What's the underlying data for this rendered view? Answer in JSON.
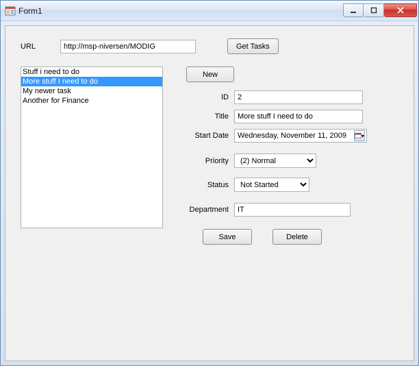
{
  "window": {
    "title": "Form1"
  },
  "url": {
    "label": "URL",
    "value": "http://msp-niversen/MODIG"
  },
  "buttons": {
    "getTasks": "Get Tasks",
    "new": "New",
    "save": "Save",
    "delete": "Delete"
  },
  "tasks": [
    {
      "label": "Stuff i need to do"
    },
    {
      "label": "More stuff I need to do"
    },
    {
      "label": "My newer task"
    },
    {
      "label": "Another for Finance"
    }
  ],
  "selectedIndex": 1,
  "fields": {
    "id": {
      "label": "ID",
      "value": "2"
    },
    "title": {
      "label": "Title",
      "value": "More stuff I need to do"
    },
    "startDate": {
      "label": "Start Date",
      "value": "Wednesday, November 11, 2009"
    },
    "priority": {
      "label": "Priority",
      "value": "(2) Normal"
    },
    "status": {
      "label": "Status",
      "value": "Not Started"
    },
    "department": {
      "label": "Department",
      "value": "IT"
    }
  }
}
